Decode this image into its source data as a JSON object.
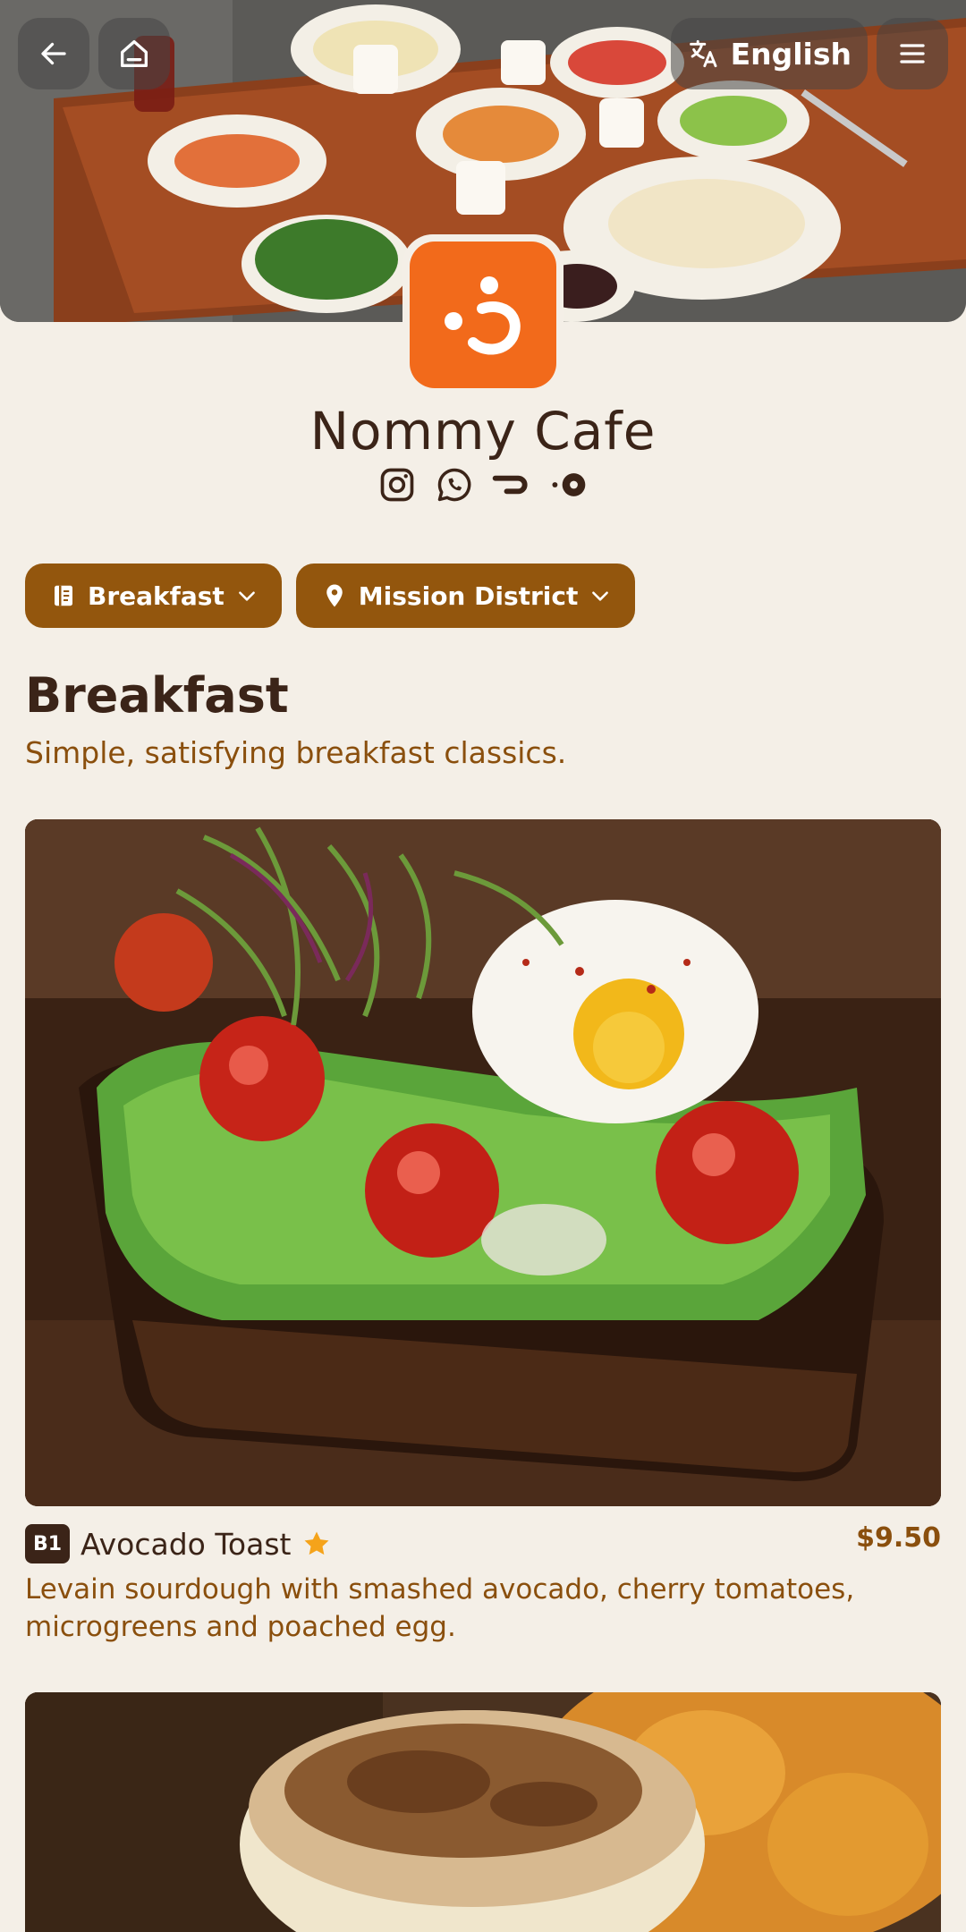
{
  "header": {
    "language_label": "English"
  },
  "cafe": {
    "name": "Nommy Cafe",
    "brand_color": "#f26a1b",
    "social_icons": [
      "instagram-icon",
      "whatsapp-icon",
      "delivery-app-icon",
      "tripadvisor-icon"
    ]
  },
  "filters": {
    "menu_label": "Breakfast",
    "location_label": "Mission District"
  },
  "section": {
    "title": "Breakfast",
    "subtitle": "Simple, satisfying breakfast classics."
  },
  "items": [
    {
      "code": "B1",
      "name": "Avocado Toast",
      "featured": true,
      "price": "$9.50",
      "description": "Levain sourdough with smashed avocado, cherry tomatoes, microgreens and poached egg."
    }
  ],
  "colors": {
    "background": "#f4efe7",
    "accent": "#93560d",
    "text": "#3b2418",
    "star": "#f5a31a"
  }
}
